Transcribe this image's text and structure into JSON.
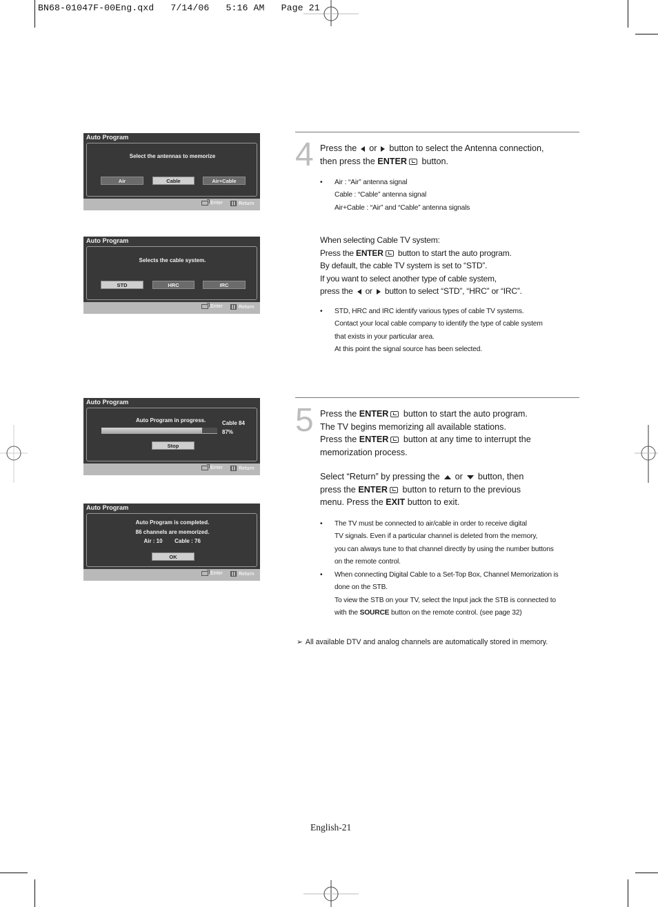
{
  "slug": "BN68-01047F-00Eng.qxd   7/14/06   5:16 AM   Page 21",
  "osd_common": {
    "title": "Auto Program",
    "enter_label": "Enter",
    "return_label": "Return"
  },
  "osd_antenna": {
    "message": "Select the antennas to memorize",
    "options": [
      "Air",
      "Cable",
      "Air+Cable"
    ],
    "selected": "Cable"
  },
  "osd_cable_system": {
    "message": "Selects the cable system.",
    "options": [
      "STD",
      "HRC",
      "IRC"
    ],
    "selected": "STD"
  },
  "osd_progress": {
    "message": "Auto Program in progress.",
    "channel": "Cable 84",
    "percent_label": "87%",
    "progress_percent": 87,
    "stop_label": "Stop"
  },
  "osd_complete": {
    "line1": "Auto Program is completed.",
    "line2": "86 channels are memorized.",
    "air": "Air : 10",
    "cable": "Cable : 76",
    "ok_label": "OK"
  },
  "step4": {
    "number": "4",
    "line1_a": "Press the",
    "or": "or",
    "line1_b": "button to select the Antenna connection,",
    "line2_a": "then press the",
    "enter": "ENTER",
    "line2_b": "button.",
    "bullets": [
      "Air : “Air” antenna signal",
      "Cable : “Cable” antenna signal",
      "Air+Cable : “Air” and “Cable” antenna signals"
    ],
    "cable_heading": "When selecting Cable TV system:",
    "cable_l1_a": "Press the",
    "cable_l1_b": "button to start the auto program.",
    "cable_l2": "By default, the cable TV system is set to “STD”.",
    "cable_l3": "If you want to select another type of cable system,",
    "cable_l4_a": "press the",
    "cable_l4_b": "button to select  “STD”, “HRC” or “IRC”.",
    "bullet2": [
      "STD, HRC and IRC identify various types of cable TV systems.",
      "Contact your local cable company to identify the type of cable system",
      "that exists in your particular area.",
      "At this point the signal source has been selected."
    ]
  },
  "step5": {
    "number": "5",
    "l1_a": "Press the",
    "enter": "ENTER",
    "l1_b": "button to start the auto program.",
    "l2": "The TV begins memorizing all available stations.",
    "l3_b": "button at any time to interrupt the",
    "l4": "memorization process.",
    "l5_a": "Select “Return” by pressing the",
    "or": "or",
    "l5_b": "button, then",
    "l6_a": "press the",
    "l6_b": "button to return to the previous",
    "l7_a": "menu. Press the",
    "exit": "EXIT",
    "l7_b": "button to exit.",
    "bullet1": [
      "The TV must be connected to air/cable in order to receive digital",
      "TV signals. Even if a particular channel is deleted from the memory,",
      "you can always tune to that channel directly by using the number buttons",
      "on the remote control."
    ],
    "bullet2": [
      "When connecting Digital Cable to a Set-Top Box, Channel Memorization is",
      "done on the STB.",
      "To view the STB on your TV, select the Input jack the STB is connected to"
    ],
    "bullet2_last_a": "with the",
    "source": "SOURCE",
    "bullet2_last_b": "button on the remote control. (see page 32)"
  },
  "note": "All available DTV and analog channels are automatically stored in memory.",
  "page_footer": "English-21"
}
